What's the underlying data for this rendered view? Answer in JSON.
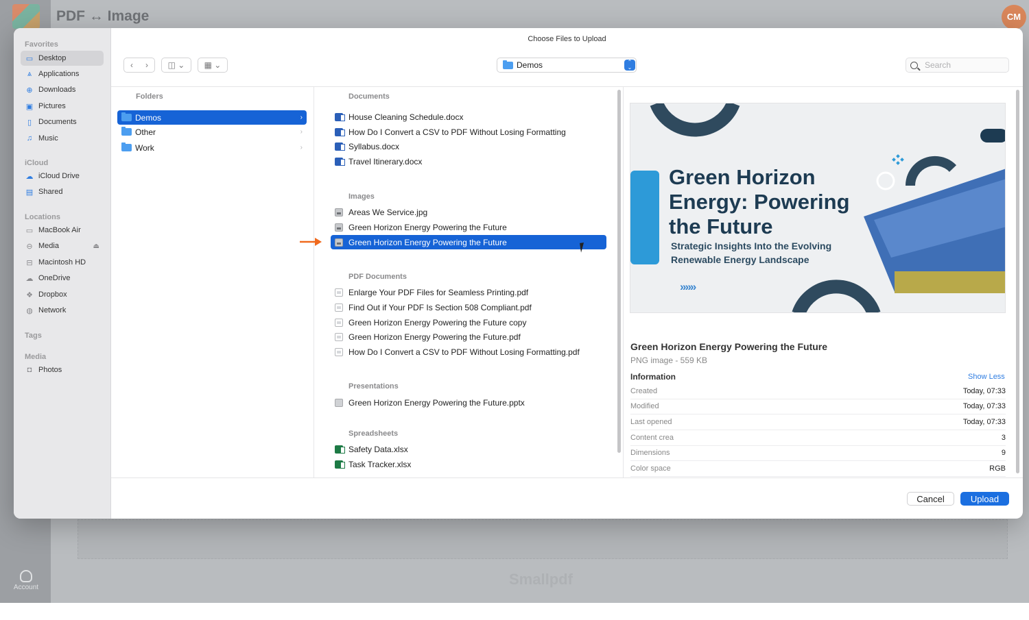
{
  "background": {
    "app_title": "PDF ↔ Image",
    "avatar_initials": "CM",
    "brand": "Smallpdf",
    "account_label": "Account"
  },
  "dialog": {
    "title": "Choose Files to Upload",
    "path": "Demos",
    "search_placeholder": "Search",
    "cancel_label": "Cancel",
    "upload_label": "Upload"
  },
  "sidebar": {
    "favorites_label": "Favorites",
    "favorites": [
      "Desktop",
      "Applications",
      "Downloads",
      "Pictures",
      "Documents",
      "Music"
    ],
    "icloud_label": "iCloud",
    "icloud": [
      "iCloud Drive",
      "Shared"
    ],
    "locations_label": "Locations",
    "locations": [
      "MacBook Air",
      "Media",
      "Macintosh HD",
      "OneDrive",
      "Dropbox",
      "Network"
    ],
    "tags_label": "Tags",
    "media_label": "Media",
    "media": [
      "Photos"
    ]
  },
  "folders": {
    "header": "Folders",
    "items": [
      "Demos",
      "Other",
      "Work"
    ]
  },
  "files": {
    "documents_label": "Documents",
    "documents": [
      "House Cleaning Schedule.docx",
      "How Do I Convert a CSV to PDF Without Losing Formatting",
      "Syllabus.docx",
      "Travel Itinerary.docx"
    ],
    "images_label": "Images",
    "images": [
      "Areas We Service.jpg",
      "Green Horizon Energy Powering the Future",
      "Green Horizon Energy Powering the Future"
    ],
    "pdf_label": "PDF Documents",
    "pdfs": [
      "Enlarge Your PDF Files for Seamless Printing.pdf",
      "Find Out if Your PDF Is Section 508 Compliant.pdf",
      "Green Horizon Energy Powering the Future copy",
      "Green Horizon Energy Powering the Future.pdf",
      "How Do I Convert a CSV to PDF Without Losing Formatting.pdf"
    ],
    "presentations_label": "Presentations",
    "presentations": [
      "Green Horizon Energy Powering the Future.pptx"
    ],
    "spreadsheets_label": "Spreadsheets",
    "spreadsheets": [
      "Safety Data.xlsx",
      "Task Tracker.xlsx"
    ]
  },
  "preview": {
    "image_title_1": "Green Horizon",
    "image_title_2": "Energy: Powering",
    "image_title_3": "the Future",
    "image_sub_1": "Strategic Insights Into the Evolving",
    "image_sub_2": "Renewable Energy Landscape",
    "chevrons": "»»»",
    "name": "Green Horizon Energy Powering the Future",
    "type": "PNG image - 559 KB",
    "info_label": "Information",
    "show_less": "Show Less",
    "rows": [
      {
        "k": "Created",
        "v": "Today, 07:33"
      },
      {
        "k": "Modified",
        "v": "Today, 07:33"
      },
      {
        "k": "Last opened",
        "v": "Today, 07:33"
      },
      {
        "k": "Content crea",
        "v": "3"
      },
      {
        "k": "Dimensions",
        "v": "9"
      },
      {
        "k": "Color space",
        "v": "RGB"
      }
    ]
  },
  "colors": {
    "selection": "#1663d6",
    "accent": "#2f7de1",
    "arrow": "#f06a1e"
  }
}
